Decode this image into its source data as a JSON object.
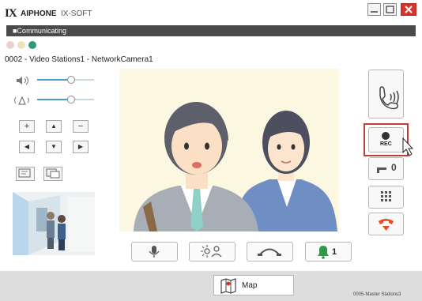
{
  "window": {
    "logo_mark": "IX",
    "brand": "AIPHONE",
    "product": "IX-SOFT",
    "controls": [
      "minimize-icon",
      "maximize-icon",
      "close-icon"
    ]
  },
  "status": {
    "text": "■Communicating",
    "indicator_colors": [
      "#e9d0d0",
      "#f1e2b6",
      "#2f9b73"
    ]
  },
  "station": {
    "title": "0002 - Video Stations1 - NetworkCamera1"
  },
  "audio": {
    "speaker_level": 0.65,
    "mic_level": 0.65,
    "icons": [
      "speaker-volume-icon",
      "microphone-volume-icon"
    ]
  },
  "camera_controls": {
    "zoom_buttons": [
      "+",
      "▲",
      "−"
    ],
    "pan_buttons": [
      "◀",
      "▼",
      "▶"
    ],
    "view_icons": [
      "snapshot-icon",
      "snapshot-list-icon"
    ]
  },
  "side_buttons": [
    {
      "name": "call-icon"
    },
    {
      "name": "record-icon",
      "label": "REC"
    },
    {
      "name": "door-key-icon",
      "label": "0"
    },
    {
      "name": "keypad-icon"
    },
    {
      "name": "hangup-icon"
    }
  ],
  "bottom_buttons": [
    {
      "name": "microphone-icon"
    },
    {
      "name": "brightness-icon"
    },
    {
      "name": "transfer-icon"
    },
    {
      "name": "bell-icon",
      "label": "1"
    }
  ],
  "footer": {
    "map_label": "Map",
    "status": "0005-Master Stations3"
  },
  "colors": {
    "accent": "#2f9b73",
    "slider": "#4b9fc7",
    "bell": "#2b9b4b",
    "hangup": "#e64a1e",
    "rec_highlight": "#c73a3a"
  }
}
